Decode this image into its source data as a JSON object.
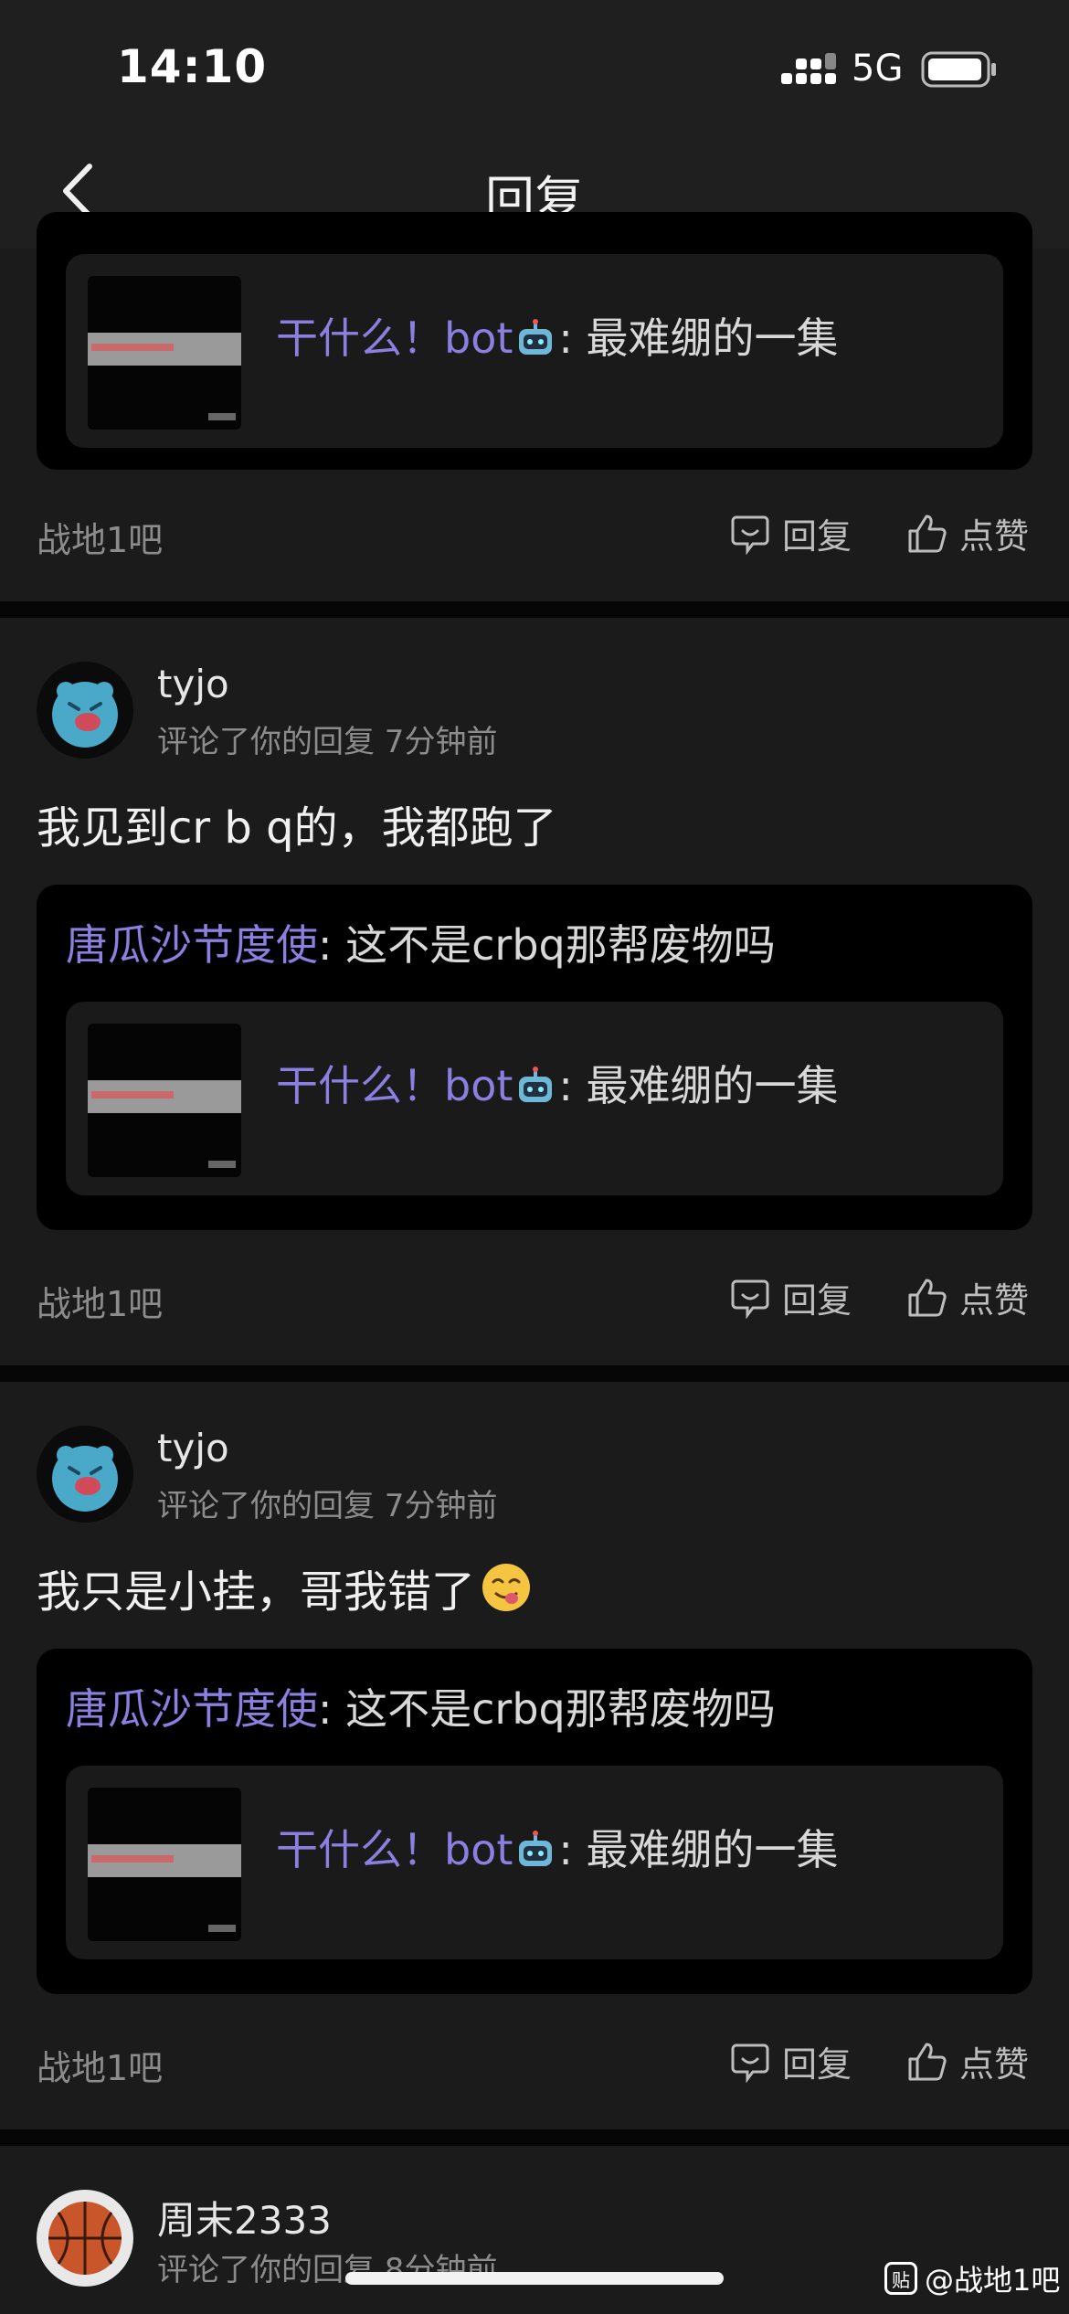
{
  "status_bar": {
    "time": "14:10",
    "network": "5G"
  },
  "header": {
    "title": "回复"
  },
  "actions": {
    "reply_label": "回复",
    "like_label": "点赞"
  },
  "items": [
    {
      "forum": "战地1吧",
      "quote_inner": {
        "author": "干什么！bot",
        "emoji": "robot",
        "text": ": 最难绷的一集"
      }
    },
    {
      "username": "tyjo",
      "meta": "评论了你的回复  7分钟前",
      "comment": "我见到cr b q的，我都跑了",
      "quote": {
        "author": "唐瓜沙节度使",
        "text": ": 这不是crbq那帮废物吗"
      },
      "quote_inner": {
        "author": "干什么！bot",
        "emoji": "robot",
        "text": ": 最难绷的一集"
      },
      "forum": "战地1吧"
    },
    {
      "username": "tyjo",
      "meta": "评论了你的回复  7分钟前",
      "comment": "我只是小挂，哥我错了",
      "comment_emoji": "tongue-face",
      "quote": {
        "author": "唐瓜沙节度使",
        "text": ": 这不是crbq那帮废物吗"
      },
      "quote_inner": {
        "author": "干什么！bot",
        "emoji": "robot",
        "text": ": 最难绷的一集"
      },
      "forum": "战地1吧"
    },
    {
      "username": "周末2333",
      "meta": "评论了你的回复  8分钟前"
    }
  ],
  "watermark": {
    "text": "@战地1吧",
    "logo": "贴"
  },
  "colors": {
    "accent_purple": "#8b7fe0",
    "background": "#141414",
    "card": "#1b1b1b"
  }
}
